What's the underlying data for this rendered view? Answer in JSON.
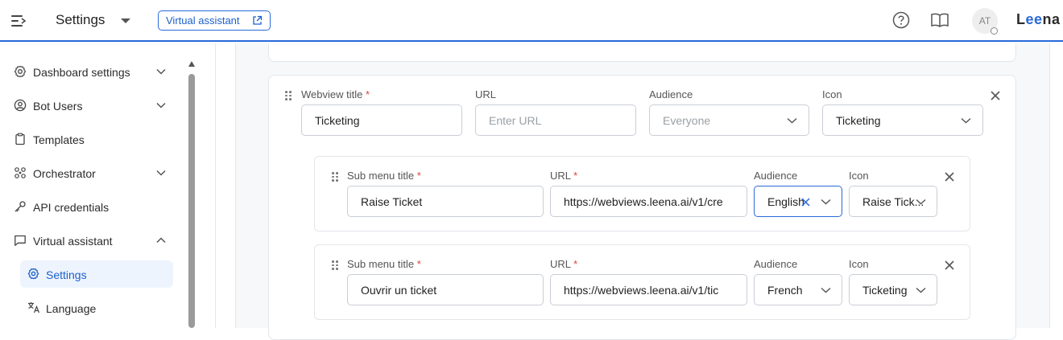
{
  "header": {
    "title": "Settings",
    "badge": "Virtual assistant",
    "avatar_initials": "AT",
    "brand_parts": [
      "L",
      "ee",
      "na"
    ]
  },
  "sidebar": {
    "items": [
      {
        "label": "Dashboard settings",
        "icon": "gear-icon",
        "expandable": true
      },
      {
        "label": "Bot Users",
        "icon": "user-circle-icon",
        "expandable": true
      },
      {
        "label": "Templates",
        "icon": "clipboard-icon",
        "expandable": false
      },
      {
        "label": "Orchestrator",
        "icon": "orchestrator-icon",
        "expandable": true
      },
      {
        "label": "API credentials",
        "icon": "key-icon",
        "expandable": false
      },
      {
        "label": "Virtual assistant",
        "icon": "chat-icon",
        "expandable": true,
        "expanded": true
      }
    ],
    "sub_items": [
      {
        "label": "Settings",
        "icon": "gear-icon",
        "active": true
      },
      {
        "label": "Language",
        "icon": "translate-icon",
        "active": false
      }
    ]
  },
  "webview": {
    "labels": {
      "title": "Webview title",
      "url": "URL",
      "audience": "Audience",
      "icon": "Icon"
    },
    "title_value": "Ticketing",
    "url_placeholder": "Enter URL",
    "audience_placeholder": "Everyone",
    "icon_value": "Ticketing"
  },
  "submenus": [
    {
      "labels": {
        "title": "Sub menu title",
        "url": "URL",
        "audience": "Audience",
        "icon": "Icon"
      },
      "title": "Raise Ticket",
      "url": "https://webviews.leena.ai/v1/cre",
      "audience": "English",
      "icon": "Raise Tick..."
    },
    {
      "labels": {
        "title": "Sub menu title",
        "url": "URL",
        "audience": "Audience",
        "icon": "Icon"
      },
      "title": "Ouvrir un ticket",
      "url": "https://webviews.leena.ai/v1/tic",
      "audience": "French",
      "icon": "Ticketing"
    }
  ],
  "required_mark": "*",
  "colors": {
    "accent": "#2a6ad9",
    "required": "#d9453b",
    "active_bg": "#eef4fd"
  }
}
